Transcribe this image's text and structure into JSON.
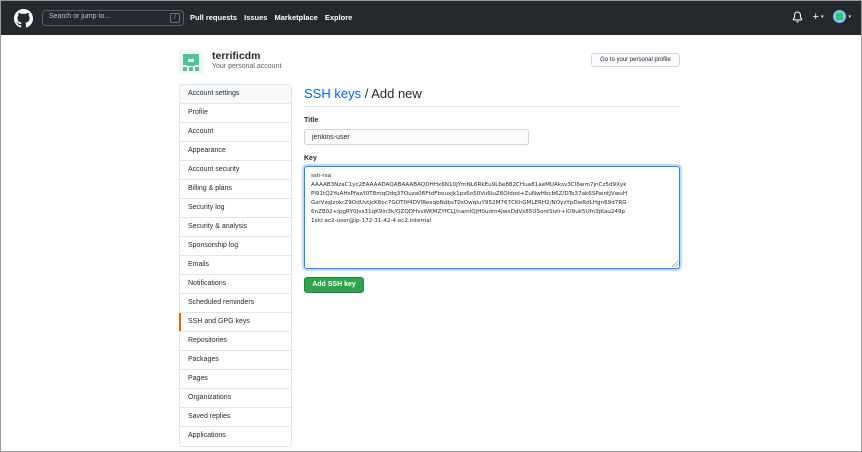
{
  "header": {
    "search_placeholder": "Search or jump to...",
    "search_shortcut": "/",
    "nav": [
      "Pull requests",
      "Issues",
      "Marketplace",
      "Explore"
    ],
    "plus": "+",
    "caret": "▾"
  },
  "profile": {
    "username": "terrificdm",
    "subtitle": "Your personal account",
    "profile_button": "Go to your personal profile"
  },
  "sidebar": {
    "items": [
      {
        "label": "Account settings"
      },
      {
        "label": "Profile"
      },
      {
        "label": "Account"
      },
      {
        "label": "Appearance"
      },
      {
        "label": "Account security"
      },
      {
        "label": "Billing & plans"
      },
      {
        "label": "Security log"
      },
      {
        "label": "Security & analysis"
      },
      {
        "label": "Sponsorship log"
      },
      {
        "label": "Emails"
      },
      {
        "label": "Notifications"
      },
      {
        "label": "Scheduled reminders"
      },
      {
        "label": "SSH and GPG keys"
      },
      {
        "label": "Repositories"
      },
      {
        "label": "Packages"
      },
      {
        "label": "Pages"
      },
      {
        "label": "Organizations"
      },
      {
        "label": "Saved replies"
      },
      {
        "label": "Applications"
      }
    ],
    "active_label": "SSH and GPG keys",
    "accent_color": "#e36209"
  },
  "main": {
    "heading_link": "SSH keys",
    "heading_rest": " / Add new",
    "title_label": "Title",
    "title_value": "jenkins-user",
    "key_label": "Key",
    "key_value": "ssh-rsa\nAAAAB3NzaC1yc2EAAAADAQABAAABAQDHHx6N10JYmNL6RkEu9L6e882CHua81aeMUAksv3Cl6wm7jnCz5d9Xyk\nPl91tQ2YuAHsPfaz/I0T8mqOdq37Ouza06FtdFbouxjk1ps6o50Vu6iuZ6QIdod+ZuNwHbcb6Z/DTo37ak6SPaintJVwuH\nGsrVzqIzokrZ9OdUvtJcK6oc7GOT0f4DVIRexqbNdbsT0sOwqIuY952M767CKhGMLERH2/NOyzYpDwRdLHgn69d7RG\n6nZ802+IpgRY0Jvs31qK9in3k/QZQDHvsWKMZYfCLJ/namlQjH0udm4JwxDdVs85USontSizlr+lO9uk5Ufn3jKau249p\n1xkI ec2-user@ip-172-31-42-4.ec2.internal",
    "submit_label": "Add SSH key",
    "submit_color": "#2ea44f"
  }
}
